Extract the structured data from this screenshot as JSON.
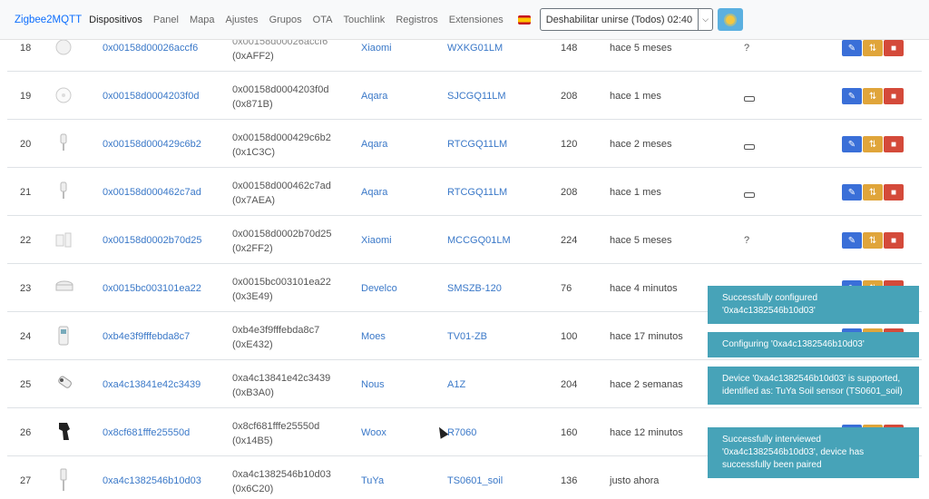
{
  "nav": {
    "brand": "Zigbee2MQTT",
    "items": [
      "Dispositivos",
      "Panel",
      "Mapa",
      "Ajustes",
      "Grupos",
      "OTA",
      "Touchlink",
      "Registros",
      "Extensiones"
    ],
    "permit_join_label": "Deshabilitar unirse (Todos) 02:40"
  },
  "rows": [
    {
      "index": "18",
      "ieee": "0x00158d00026accf6",
      "nwk1": "0x00158d00026accf6",
      "nwk2": "(0xAFF2)",
      "vendor": "Xiaomi",
      "model": "WXKG01LM",
      "lqi": "148",
      "last_seen": "hace 5 meses",
      "power": "?"
    },
    {
      "index": "19",
      "ieee": "0x00158d0004203f0d",
      "nwk1": "0x00158d0004203f0d",
      "nwk2": "(0x871B)",
      "vendor": "Aqara",
      "model": "SJCGQ11LM",
      "lqi": "208",
      "last_seen": "hace 1 mes",
      "power": "battery"
    },
    {
      "index": "20",
      "ieee": "0x00158d000429c6b2",
      "nwk1": "0x00158d000429c6b2",
      "nwk2": "(0x1C3C)",
      "vendor": "Aqara",
      "model": "RTCGQ11LM",
      "lqi": "120",
      "last_seen": "hace 2 meses",
      "power": "battery"
    },
    {
      "index": "21",
      "ieee": "0x00158d000462c7ad",
      "nwk1": "0x00158d000462c7ad",
      "nwk2": "(0x7AEA)",
      "vendor": "Aqara",
      "model": "RTCGQ11LM",
      "lqi": "208",
      "last_seen": "hace 1 mes",
      "power": "battery"
    },
    {
      "index": "22",
      "ieee": "0x00158d0002b70d25",
      "nwk1": "0x00158d0002b70d25",
      "nwk2": "(0x2FF2)",
      "vendor": "Xiaomi",
      "model": "MCCGQ01LM",
      "lqi": "224",
      "last_seen": "hace 5 meses",
      "power": "?"
    },
    {
      "index": "23",
      "ieee": "0x0015bc003101ea22",
      "nwk1": "0x0015bc003101ea22",
      "nwk2": "(0x3E49)",
      "vendor": "Develco",
      "model": "SMSZB-120",
      "lqi": "76",
      "last_seen": "hace 4 minutos",
      "power": ""
    },
    {
      "index": "24",
      "ieee": "0xb4e3f9fffebda8c7",
      "nwk1": "0xb4e3f9fffebda8c7",
      "nwk2": "(0xE432)",
      "vendor": "Moes",
      "model": "TV01-ZB",
      "lqi": "100",
      "last_seen": "hace 17 minutos",
      "power": ""
    },
    {
      "index": "25",
      "ieee": "0xa4c13841e42c3439",
      "nwk1": "0xa4c13841e42c3439",
      "nwk2": "(0xB3A0)",
      "vendor": "Nous",
      "model": "A1Z",
      "lqi": "204",
      "last_seen": "hace 2 semanas",
      "power": ""
    },
    {
      "index": "26",
      "ieee": "0x8cf681fffe25550d",
      "nwk1": "0x8cf681fffe25550d",
      "nwk2": "(0x14B5)",
      "vendor": "Woox",
      "model": "R7060",
      "lqi": "160",
      "last_seen": "hace 12 minutos",
      "power": ""
    },
    {
      "index": "27",
      "ieee": "0xa4c1382546b10d03",
      "nwk1": "0xa4c1382546b10d03",
      "nwk2": "(0x6C20)",
      "vendor": "TuYa",
      "model": "TS0601_soil",
      "lqi": "136",
      "last_seen": "justo ahora",
      "power": ""
    }
  ],
  "toasts": [
    "Successfully configured '0xa4c1382546b10d03'",
    "Configuring '0xa4c1382546b10d03'",
    "Device '0xa4c1382546b10d03' is supported, identified as: TuYa Soil sensor (TS0601_soil)",
    "Successfully interviewed '0xa4c1382546b10d03', device has successfully been paired"
  ],
  "colors": {
    "link": "#3a78c8",
    "edit": "#3a6fd8",
    "rename": "#e0a53a",
    "delete": "#d44a3a",
    "toast": "#47a3b8"
  },
  "icons": {
    "edit": "pencil-icon",
    "rename": "rename-icon",
    "delete": "trash-icon",
    "theme": "sun-icon",
    "battery": "battery-icon"
  }
}
